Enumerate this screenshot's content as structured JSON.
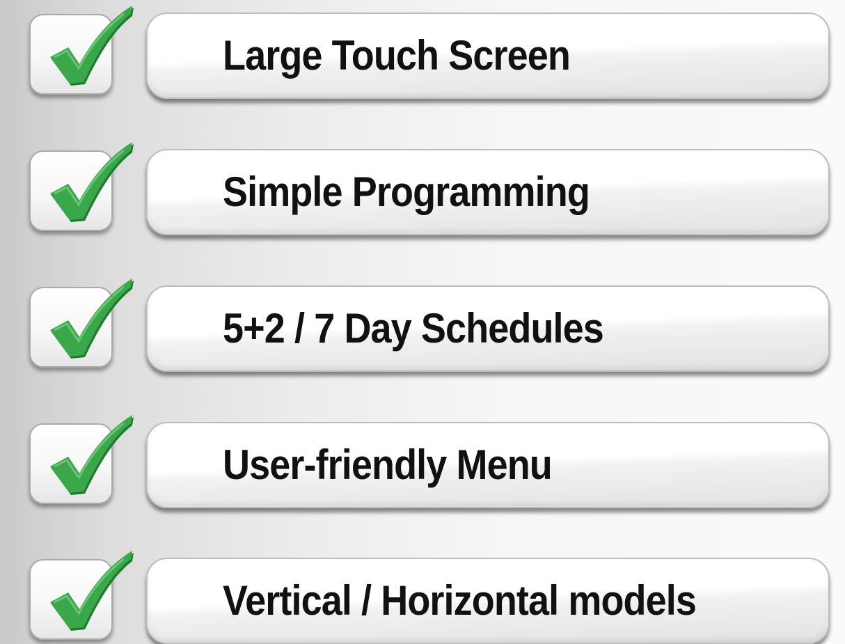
{
  "features": [
    {
      "label": "Large Touch Screen",
      "checked": true
    },
    {
      "label": "Simple Programming",
      "checked": true
    },
    {
      "label": "5+2 / 7 Day Schedules",
      "checked": true
    },
    {
      "label": "User-friendly Menu",
      "checked": true
    },
    {
      "label": "Vertical / Horizontal models",
      "checked": true
    }
  ],
  "colors": {
    "check_green": "#3aa84a",
    "check_green_dark": "#1e7a2e",
    "text": "#111111"
  },
  "icons": {
    "check": "check-icon"
  }
}
